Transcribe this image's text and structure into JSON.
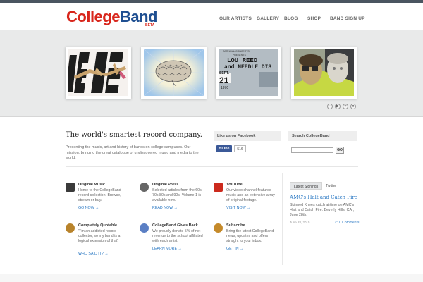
{
  "header": {
    "logo_part1": "College",
    "logo_part2": "Band",
    "logo_badge": "BETA",
    "nav": [
      "OUR ARTISTS",
      "GALLERY",
      "BLOG",
      "SHOP",
      "BAND SIGN UP"
    ]
  },
  "hero": {
    "thumbnails": [
      {
        "name": "abstract-bars-art"
      },
      {
        "name": "brain-art"
      },
      {
        "name": "concert-ticket-art"
      },
      {
        "name": "faces-collage-art"
      }
    ],
    "ticket_text": {
      "line1": "CARNIVAL CONCERTS",
      "line2": "PRESENTS",
      "line3": "LOU REED",
      "line4": "and NEEDLE DIS",
      "day": "21",
      "month": "SEPT.",
      "year": "1970"
    },
    "controls": [
      "−",
      "▶",
      "+",
      "●"
    ]
  },
  "main": {
    "tagline": "The world's smartest record company.",
    "intro": "Presenting the music, art and history of bands on college campuses. Our mission: bringing the great catalogue of undiscovered music and media to the world.",
    "facebook_head": "Like us on Facebook",
    "fb_like": "Like",
    "fb_count": "516",
    "search_head": "Search CollegeBand",
    "search_go": "GO"
  },
  "features": [
    {
      "title": "Original Music",
      "body": "Home to the CollegeBand record collection. Browse, stream or buy.",
      "link": "GO NOW →",
      "icon": "music-icon",
      "icon_color": "#3a3a3a"
    },
    {
      "title": "Original Press",
      "body": "Selected articles from the 60s 70s 80s and 90s. Volume 1 is available now.",
      "link": "READ NOW →",
      "icon": "press-icon",
      "icon_color": "#666666"
    },
    {
      "title": "YouTube",
      "body": "Our video channel features music and an extensive array of original footage.",
      "link": "VISIT NOW →",
      "icon": "youtube-icon",
      "icon_color": "#cc2a1d"
    },
    {
      "title": "Completely Quotable",
      "body": "\"I'm an addicted record collector, so my band is a logical extension of that\"",
      "link": "WHO SAID IT? →",
      "icon": "quote-icon",
      "icon_color": "#b8832b"
    },
    {
      "title": "CollegeBand Gives Back",
      "body": "We proudly donate 5% of net revenue to the school affiliated with each artist.",
      "link": "LEARN MORE →",
      "icon": "gives-back-icon",
      "icon_color": "#5b7fc4"
    },
    {
      "title": "Subscribe",
      "body": "Bring the latest CollegeBand news, updates and offers straight to your inbox.",
      "link": "GET IN →",
      "icon": "subscribe-icon",
      "icon_color": "#c58a2a"
    }
  ],
  "sidebar": {
    "tabs": [
      "Latest Signings",
      "Twitter"
    ],
    "post_title": "AMC's Halt and Catch Fire",
    "post_body": "Skinned Knees catch airtime on AMC's Halt and Catch Fire. Beverly Hills, CA., June 28th.",
    "post_date": "June 28, 2015",
    "post_comments": "0 Comments"
  }
}
